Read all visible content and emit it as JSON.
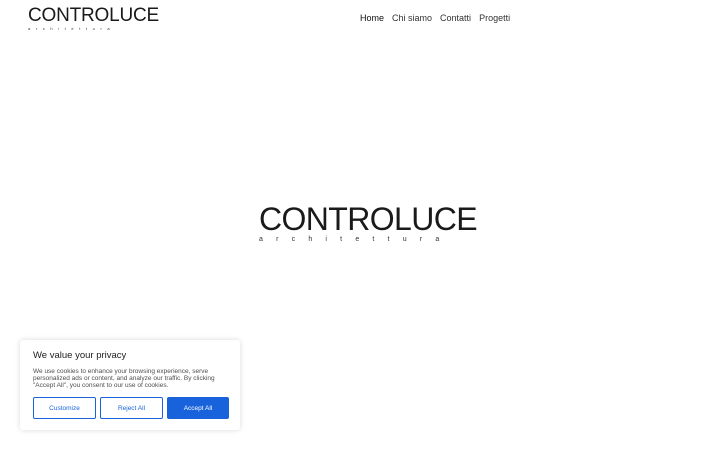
{
  "header": {
    "logo_word": "CONTROLUCE",
    "logo_sub": "architettura"
  },
  "nav": {
    "items": [
      {
        "label": "Home",
        "active": true
      },
      {
        "label": "Chi siamo",
        "active": false
      },
      {
        "label": "Contatti",
        "active": false
      },
      {
        "label": "Progetti",
        "active": false
      }
    ]
  },
  "hero": {
    "logo_word": "CONTROLUCE",
    "logo_sub": "architettura"
  },
  "cookie_banner": {
    "title": "We value your privacy",
    "text": "We use cookies to enhance your browsing experience, serve personalized ads or content, and analyze our traffic. By clicking \"Accept All\", you consent to our use of cookies.",
    "customize_label": "Customize",
    "reject_label": "Reject All",
    "accept_label": "Accept All",
    "accent_color": "#1863dc"
  }
}
